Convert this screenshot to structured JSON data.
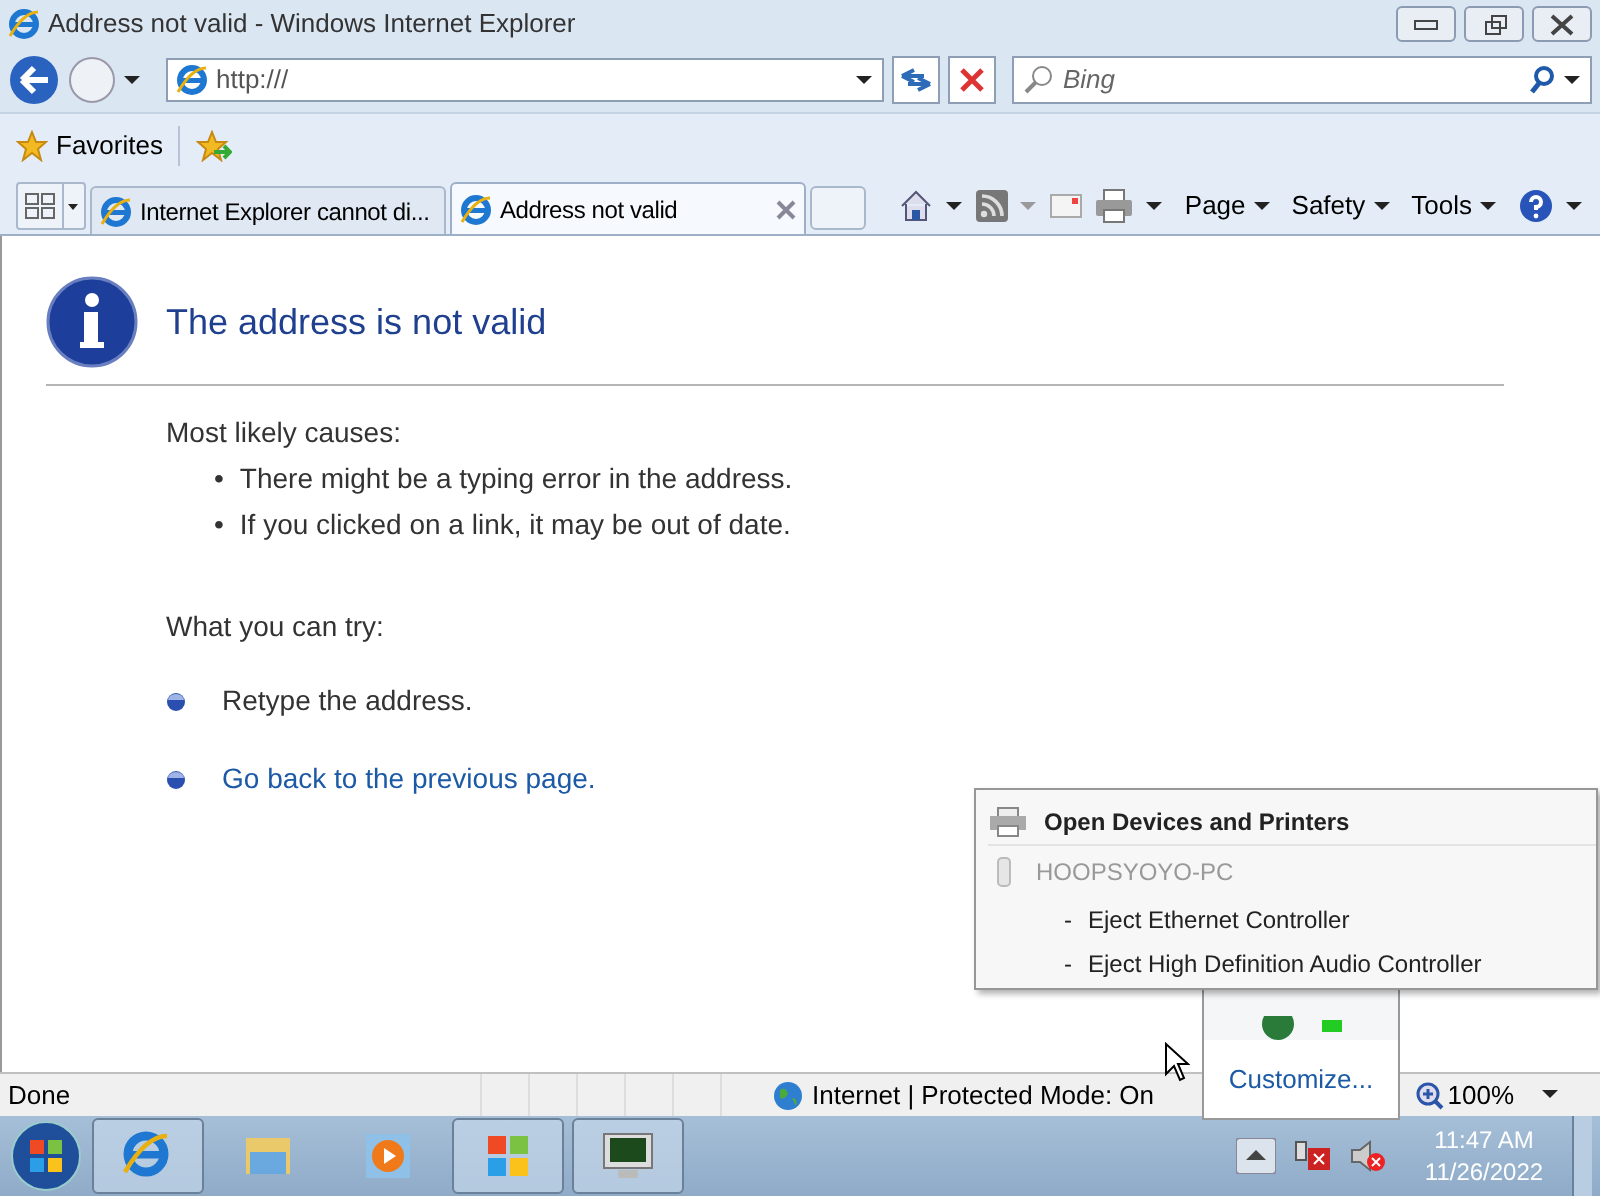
{
  "window": {
    "title": "Address not valid - Windows Internet Explorer"
  },
  "address_bar": {
    "value": "http:///"
  },
  "search": {
    "placeholder": "Bing"
  },
  "favorites": {
    "label": "Favorites"
  },
  "tabs": [
    {
      "label": "Internet Explorer cannot di...",
      "selected": false
    },
    {
      "label": "Address not valid",
      "selected": true
    }
  ],
  "commands": [
    "Page",
    "Safety",
    "Tools"
  ],
  "content": {
    "heading": "The address is not valid",
    "causes_title": "Most likely causes:",
    "causes": [
      {
        "bullet": "•",
        "text": "There might be a typing error in the address."
      },
      {
        "bullet": "•",
        "text": "If you clicked on a link, it may be out of date."
      }
    ],
    "try_title": "What you can try:",
    "try_items": [
      {
        "kind": "text",
        "text": "Retype the address."
      },
      {
        "kind": "link",
        "text": "Go back to the previous page."
      }
    ]
  },
  "status_bar": {
    "text": "Done",
    "zone": "Internet | Protected Mode: On",
    "zoom": "100%"
  },
  "tray_popup": {
    "header": "Open Devices and Printers",
    "computer": "HOOPSYOYO-PC",
    "items": [
      {
        "marker": "-",
        "label": "Eject Ethernet Controller"
      },
      {
        "marker": "-",
        "label": "Eject High Definition Audio Controller"
      }
    ]
  },
  "tray_overflow": {
    "link": "Customize..."
  },
  "taskbar": {
    "items": [
      {
        "kind": "ie",
        "running": true
      },
      {
        "kind": "folder",
        "running": false
      },
      {
        "kind": "media",
        "running": false
      },
      {
        "kind": "windows",
        "running": true
      },
      {
        "kind": "monitor",
        "running": true
      }
    ]
  },
  "clock": {
    "time": "11:47 AM",
    "date": "11/26/2022"
  }
}
